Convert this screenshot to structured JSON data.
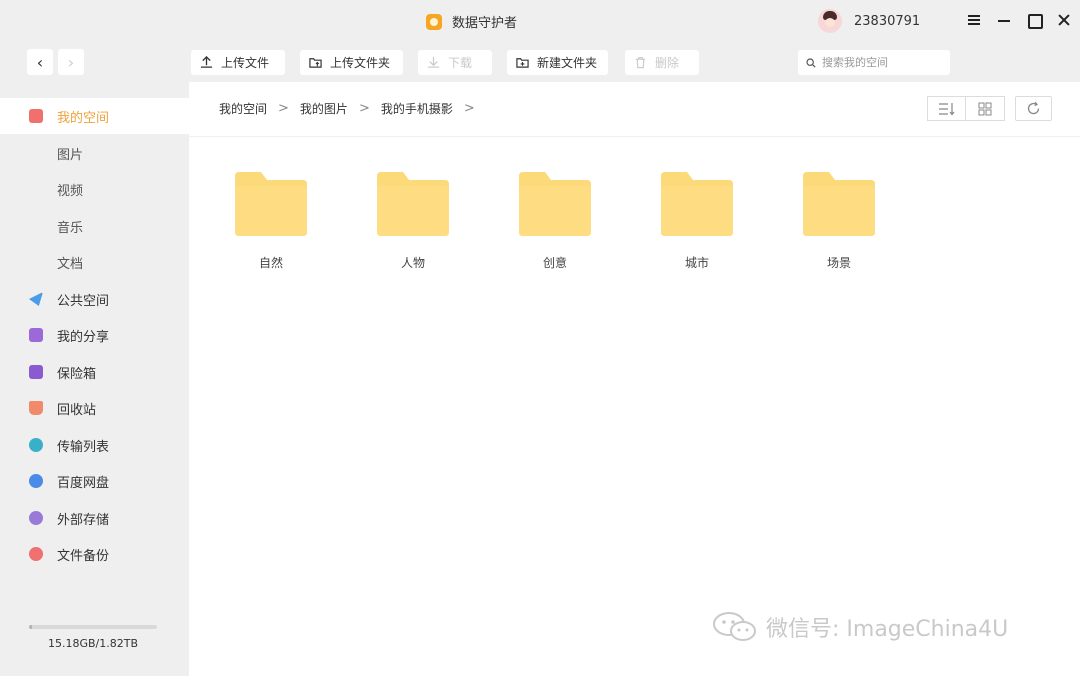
{
  "window": {
    "title": "数据守护者",
    "user_id": "23830791"
  },
  "toolbar": {
    "back_label": "‹",
    "forward_label": "›",
    "upload_file": "上传文件",
    "upload_folder": "上传文件夹",
    "download": "下载",
    "new_folder": "新建文件夹",
    "delete": "删除",
    "search_placeholder": "搜索我的空间"
  },
  "sidebar": {
    "items": [
      {
        "label": "我的空间",
        "icon": "my-space-icon",
        "color": "#f07070"
      },
      {
        "label": "图片"
      },
      {
        "label": "视频"
      },
      {
        "label": "音乐"
      },
      {
        "label": "文档"
      },
      {
        "label": "公共空间",
        "icon": "public-space-icon",
        "color": "#4a9be8"
      },
      {
        "label": "我的分享",
        "icon": "share-icon",
        "color": "#9b6ad8"
      },
      {
        "label": "保险箱",
        "icon": "safe-icon",
        "color": "#8a5ad0"
      },
      {
        "label": "回收站",
        "icon": "recycle-bin-icon",
        "color": "#f08a6a"
      },
      {
        "label": "传输列表",
        "icon": "transfer-icon",
        "color": "#3ab0c8"
      },
      {
        "label": "百度网盘",
        "icon": "baidu-netdisk-icon",
        "color": "#4a8ae8"
      },
      {
        "label": "外部存储",
        "icon": "external-storage-icon",
        "color": "#9a7ad8"
      },
      {
        "label": "文件备份",
        "icon": "backup-icon",
        "color": "#f07070"
      }
    ],
    "storage": {
      "text": "15.18GB/1.82TB",
      "used_fraction": 0.008
    }
  },
  "breadcrumb": [
    "我的空间",
    "我的图片",
    "我的手机摄影"
  ],
  "folders": [
    "自然",
    "人物",
    "创意",
    "城市",
    "场景"
  ],
  "colors": {
    "accent": "#f0a23a",
    "folder": "#fcd979"
  },
  "watermark": "微信号: ImageChina4U"
}
